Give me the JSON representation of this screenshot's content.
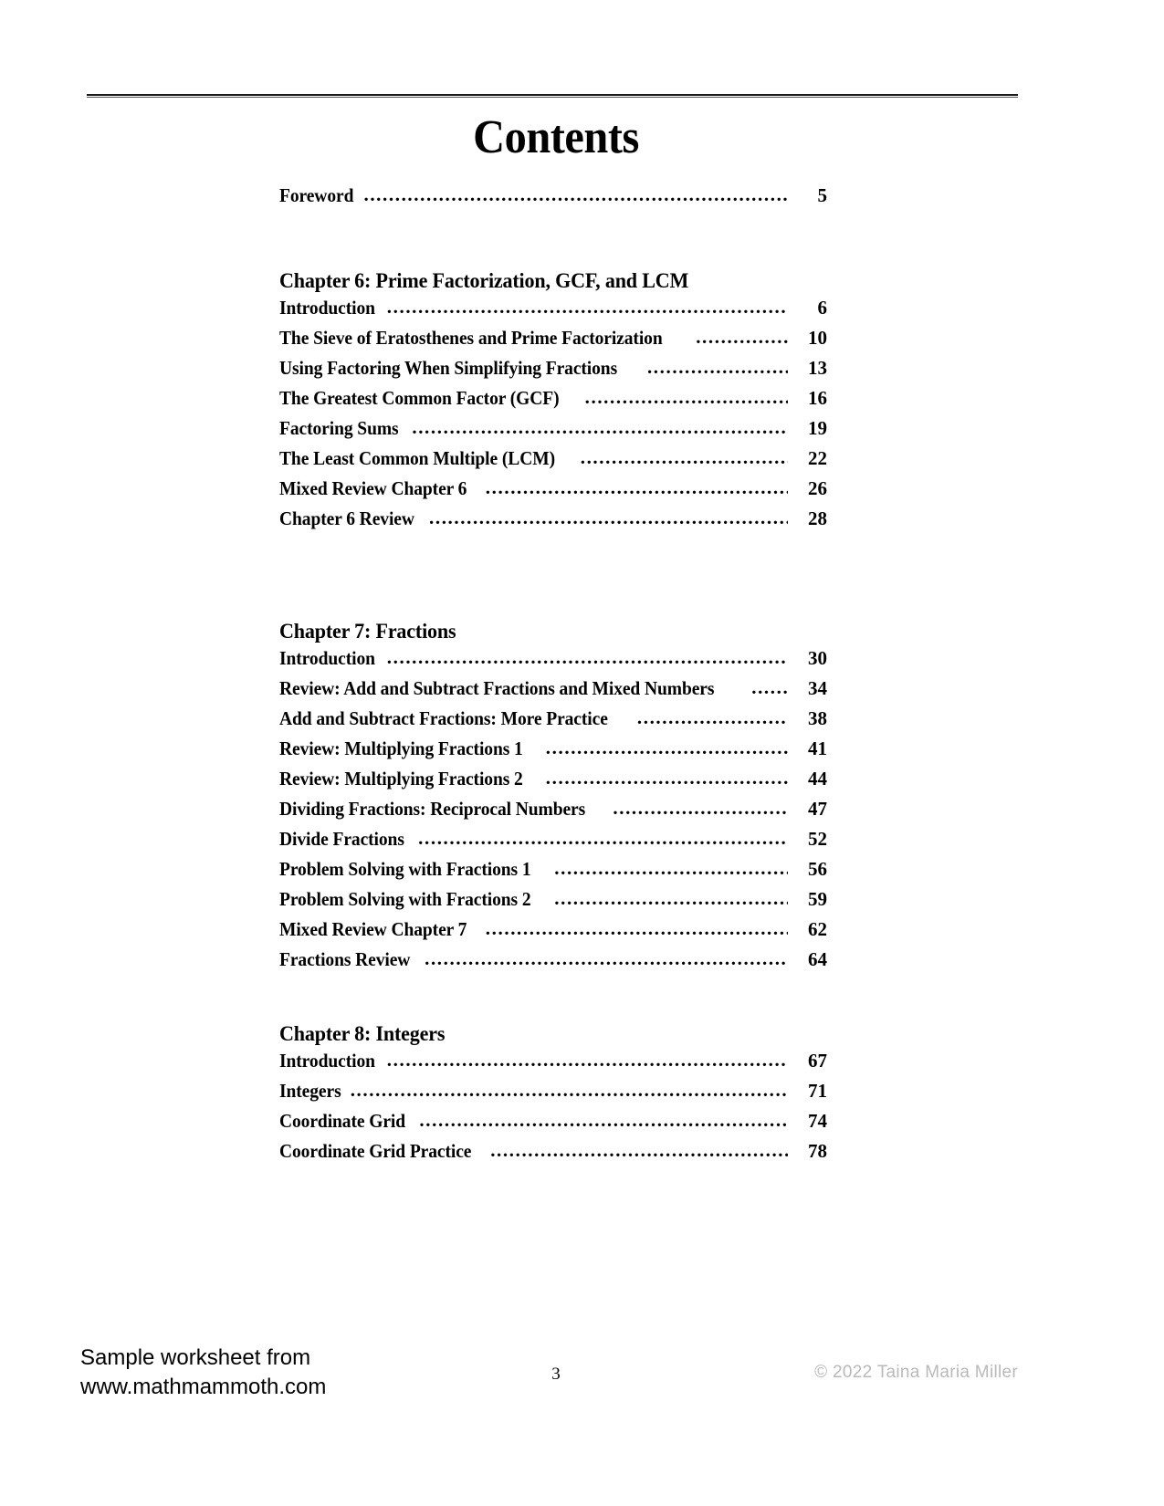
{
  "document": {
    "title": "Contents",
    "page_number": "3"
  },
  "toc": {
    "front_matter": [
      {
        "title": "Foreword",
        "page": "5"
      }
    ],
    "chapters": [
      {
        "heading": "Chapter 6: Prime Factorization, GCF, and LCM",
        "entries": [
          {
            "title": "Introduction",
            "page": "6"
          },
          {
            "title": "The Sieve of Eratosthenes and Prime Factorization",
            "page": "10"
          },
          {
            "title": "Using Factoring When Simplifying Fractions",
            "page": "13"
          },
          {
            "title": "The Greatest Common Factor (GCF)",
            "page": "16"
          },
          {
            "title": "Factoring Sums",
            "page": "19"
          },
          {
            "title": "The Least Common Multiple (LCM)",
            "page": "22"
          },
          {
            "title": "Mixed Review Chapter 6",
            "page": "26"
          },
          {
            "title": "Chapter 6 Review",
            "page": "28"
          }
        ]
      },
      {
        "heading": "Chapter 7: Fractions",
        "entries": [
          {
            "title": "Introduction",
            "page": "30"
          },
          {
            "title": "Review: Add and Subtract Fractions and Mixed Numbers",
            "page": "34"
          },
          {
            "title": "Add and Subtract Fractions: More Practice",
            "page": "38"
          },
          {
            "title": "Review: Multiplying Fractions 1",
            "page": "41"
          },
          {
            "title": "Review: Multiplying Fractions 2",
            "page": "44"
          },
          {
            "title": "Dividing Fractions: Reciprocal Numbers",
            "page": "47"
          },
          {
            "title": "Divide Fractions",
            "page": "52"
          },
          {
            "title": "Problem Solving with Fractions 1",
            "page": "56"
          },
          {
            "title": "Problem Solving with Fractions 2",
            "page": "59"
          },
          {
            "title": "Mixed Review Chapter 7",
            "page": "62"
          },
          {
            "title": "Fractions Review",
            "page": "64"
          }
        ]
      },
      {
        "heading": "Chapter 8: Integers",
        "entries": [
          {
            "title": "Introduction",
            "page": "67"
          },
          {
            "title": "Integers",
            "page": "71"
          },
          {
            "title": "Coordinate Grid",
            "page": "74"
          },
          {
            "title": "Coordinate Grid Practice",
            "page": "78"
          }
        ]
      }
    ]
  },
  "footer": {
    "sample_line_1": "Sample worksheet from",
    "sample_line_2": "www.mathmammoth.com",
    "copyright": "© 2022 Taina Maria Miller"
  }
}
